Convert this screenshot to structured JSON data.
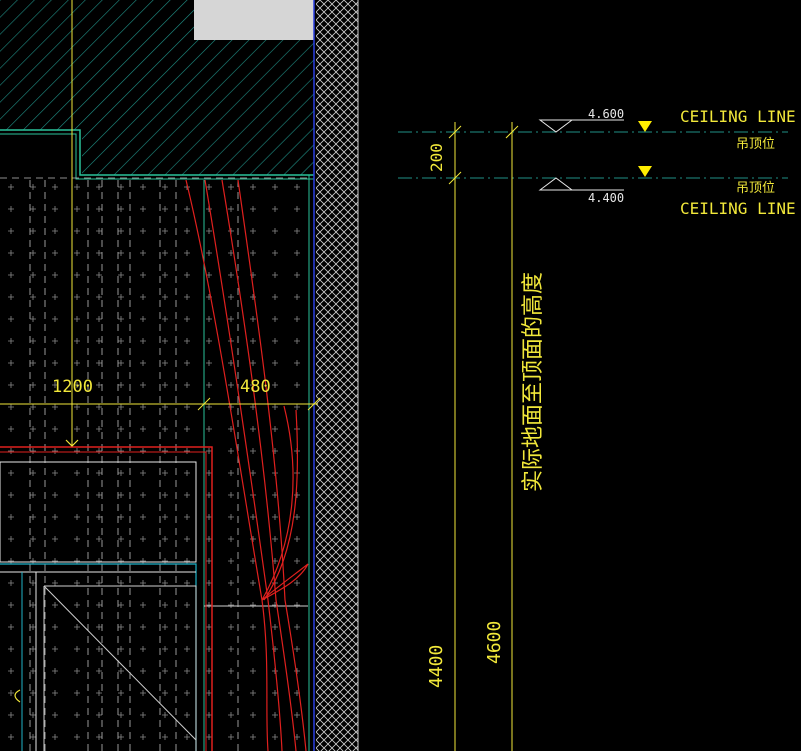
{
  "dimensions": {
    "width_top": "1200",
    "width_top_right": "480",
    "offset_height": "200",
    "height_ceiling_low": "4400",
    "height_ceiling_high": "4600"
  },
  "levels": {
    "upper_value": "4.600",
    "lower_value": "4.400",
    "upper_tag": "CEILING LINE",
    "lower_tag": "CEILING LINE",
    "upper_note": "吊顶位",
    "lower_note": "吊顶位"
  },
  "annotations": {
    "vertical_note": "实际地面至顶面的高度"
  },
  "colors": {
    "background": "#000000",
    "dimension": "#f2e83a",
    "wall_hatch": "#1f8f86",
    "curtain": "#e0201e",
    "window_frame": "#1fb3c9",
    "wall_blue": "#2a3fe0",
    "text_white": "#e8e8e8",
    "marker": "#ffee00"
  }
}
